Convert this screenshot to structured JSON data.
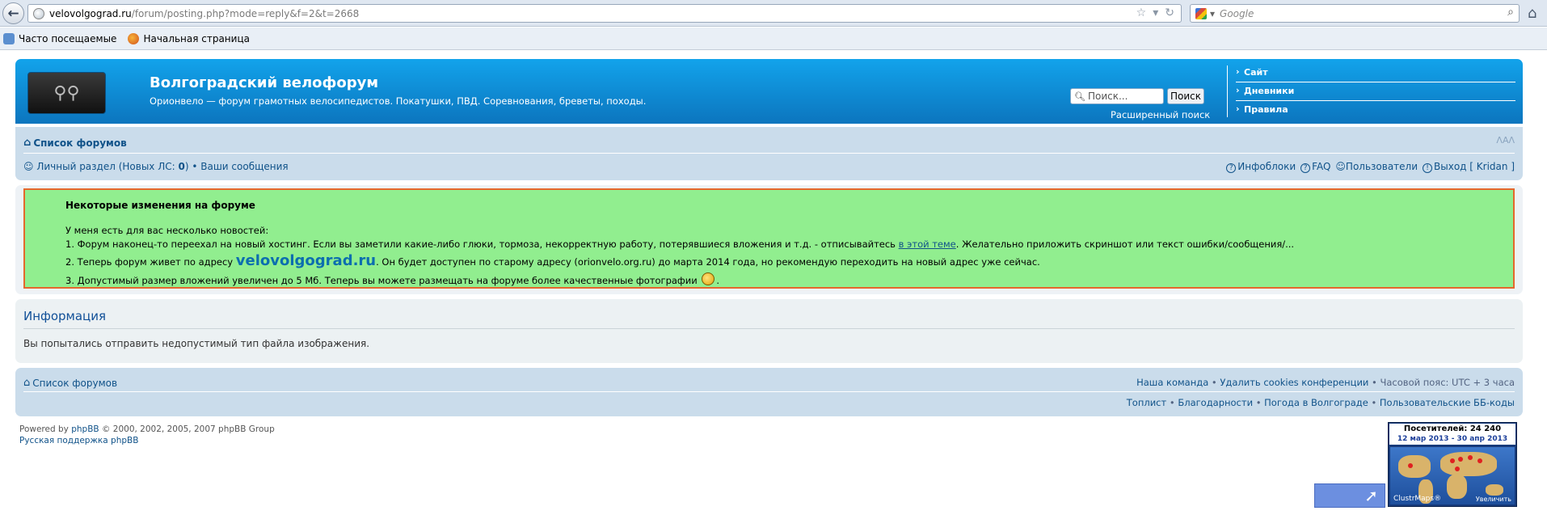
{
  "browser": {
    "url_domain": "velovolgograd.ru",
    "url_path": "/forum/posting.php?mode=reply&f=2&t=2668",
    "search_placeholder": "Google",
    "bookmarks": [
      "Часто посещаемые",
      "Начальная страница"
    ]
  },
  "header": {
    "title": "Волгоградский велофорум",
    "description": "Орионвело — форум грамотных велосипедистов. Покатушки, ПВД. Соревнования, бреветы, походы.",
    "search_placeholder": "Поиск...",
    "search_button": "Поиск",
    "advanced_search": "Расширенный поиск",
    "quicklinks": [
      "Сайт",
      "Дневники",
      "Правила"
    ]
  },
  "navbar": {
    "index_link": "Список форумов",
    "font_resize": "ᐱAᐱ",
    "pm_text": "Личный раздел (Новых ЛС: ",
    "pm_count": "0",
    "pm_close": ") • ",
    "your_posts": "Ваши сообщения",
    "infoblocks": "Инфоблоки",
    "faq": "FAQ",
    "members": "Пользователи",
    "logout": "Выход [ Kridan ]"
  },
  "notice": {
    "title": "Некоторые изменения на форуме",
    "intro": "У меня есть для вас несколько новостей:",
    "item1_pre": "1. Форум наконец-то переехал на новый хостинг. Если вы заметили какие-либо глюки, тормоза, некорректную работу, потерявшиеся вложения и т.д. - отписывайтесь ",
    "item1_link": "в этой теме",
    "item1_post": ". Желательно приложить скриншот или текст ошибки/сообщения/...",
    "item2_pre": "2. Теперь форум живет по адресу ",
    "item2_site": "velovolgograd.ru",
    "item2_post": ". Он будет доступен по старому адресу (orionvelo.org.ru) до марта 2014 года, но рекомендую переходить на новый адрес уже сейчас.",
    "item3_pre": "3. Допустимый размер вложений увеличен до 5 Мб. Теперь вы можете размещать на форуме более качественные фотографии ",
    "item3_post": "."
  },
  "info": {
    "title": "Информация",
    "message": "Вы попытались отправить недопустимый тип файла изображения."
  },
  "footer": {
    "index_link": "Список форумов",
    "team": "Наша команда",
    "delete_cookies": "Удалить cookies конференции",
    "timezone": "Часовой пояс: UTC + 3 часа",
    "toplist": "Топлист",
    "thanks": "Благодарности",
    "weather": "Погода в Волгограде",
    "bbcodes": "Пользовательские ББ-коды",
    "powered_pre": "Powered by ",
    "powered_link": "phpBB",
    "powered_post": " © 2000, 2002, 2005, 2007 phpBB Group",
    "support": "Русская поддержка phpBB"
  },
  "clustrmaps": {
    "visitors": "Посетителей: 24 240",
    "dates": "12 мар 2013 - 30 апр 2013",
    "label": "ClustrMaps®",
    "zoom": "Увеличить"
  }
}
